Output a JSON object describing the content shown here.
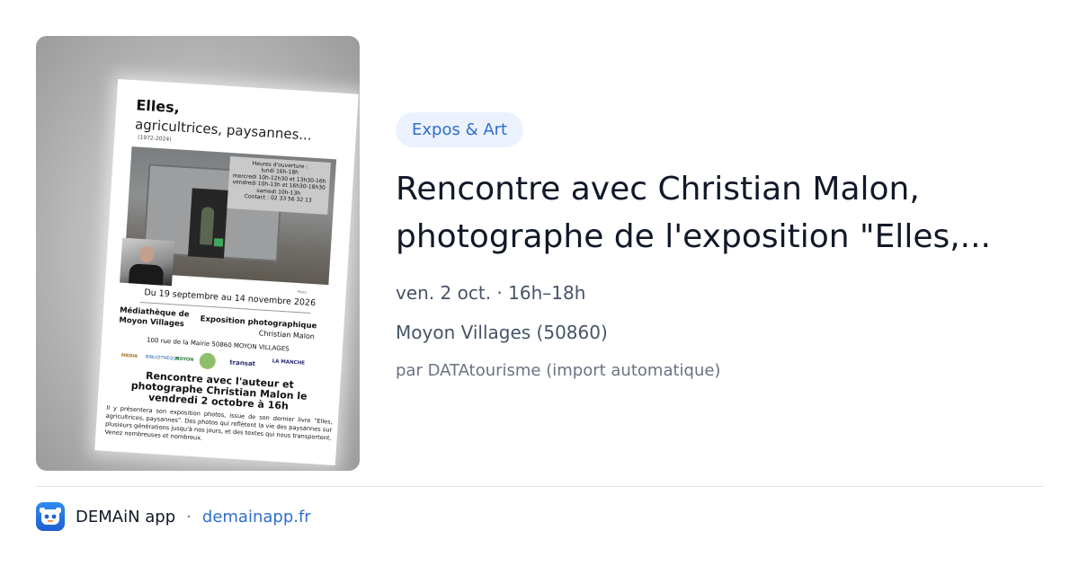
{
  "event_image": {
    "poster": {
      "title": "Elles,",
      "subtitle": "agricultrices, paysannes...",
      "years": "(1972-2024)",
      "hours": [
        "Heures d'ouverture :",
        "lundi 16h-18h",
        "mercredi 10h-12h30 et 13h30-16h",
        "vendredi 10h-13h et 16h30-18h30",
        "samedi 10h-13h",
        "Contact : 02 33 56 32 13"
      ],
      "dates": "Du 19 septembre au 14 novembre 2026",
      "venue_line1": "Médiathèque de",
      "venue_line2": "Moyon Villages",
      "expo": "Exposition photographique",
      "artist": "Christian Malon",
      "address": "100 rue de la Mairie 50860 MOYON VILLAGES",
      "logos": [
        "MEDIA",
        "BIBLIOTHÈQUE",
        "MOYON",
        "",
        "transat",
        "LA MANCHE"
      ],
      "headline": "Rencontre avec l'auteur et photographe Christian Malon le vendredi 2 octobre à 16h",
      "body": "Il y présentera son exposition photos, issue de son dernier livre \"Elles, agricultrices, paysannes\". Des photos qui reflètent la vie des paysannes sur plusieurs générations jusqu'à nos jours, et des textes qui nous transportent. Venez nombreuses et nombreux."
    }
  },
  "category_tag": "Expos & Art",
  "title_line1": "Rencontre avec Christian Malon,",
  "title_line2": "photographe de l'exposition \"Elles,...",
  "when": "ven. 2 oct. · 16h–18h",
  "where": "Moyon Villages (50860)",
  "source": "par DATAtourisme (import automatique)",
  "footer": {
    "app_name": "DEMAiN app",
    "separator": "·",
    "url": "demainapp.fr",
    "icon": "demain-app-icon"
  },
  "colors": {
    "tag_background": "#ecf2fd",
    "accent_blue": "#2f6fcf",
    "title": "#111827",
    "meta": "#475467"
  }
}
